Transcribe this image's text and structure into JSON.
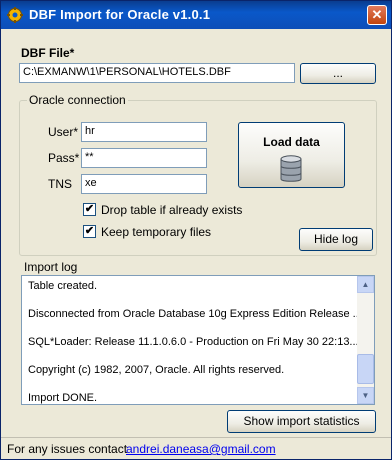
{
  "window": {
    "title": "DBF Import for Oracle v1.0.1",
    "close_glyph": "✕"
  },
  "dbf": {
    "label": "DBF File*",
    "path": "C:\\EXMANW\\1\\PERSONAL\\HOTELS.DBF",
    "browse_label": "..."
  },
  "oracle": {
    "group_title": "Oracle connection",
    "user_label": "User*",
    "user_value": "hr",
    "pass_label": "Pass*",
    "pass_value": "**",
    "tns_label": "TNS",
    "tns_value": "xe",
    "load_label": "Load data",
    "drop_table_label": "Drop table if already exists",
    "drop_table_checked": "✔",
    "keep_temp_label": "Keep temporary files",
    "keep_temp_checked": "✔",
    "hide_log_label": "Hide log"
  },
  "log": {
    "label": "Import log",
    "lines": [
      "Table created.",
      "Disconnected from Oracle Database 10g Express Edition Release ...",
      "SQL*Loader: Release 11.1.0.6.0 - Production on Fri May 30 22:13...",
      "Copyright (c) 1982, 2007, Oracle.  All rights reserved.",
      "Import DONE."
    ],
    "stats_button": "Show import statistics"
  },
  "footer": {
    "text": "For any issues contact",
    "email": "andrei.daneasa@gmail.com"
  },
  "icons": {
    "app": "gear-icon",
    "database": "database-icon",
    "scroll_up": "▲",
    "scroll_down": "▼"
  }
}
